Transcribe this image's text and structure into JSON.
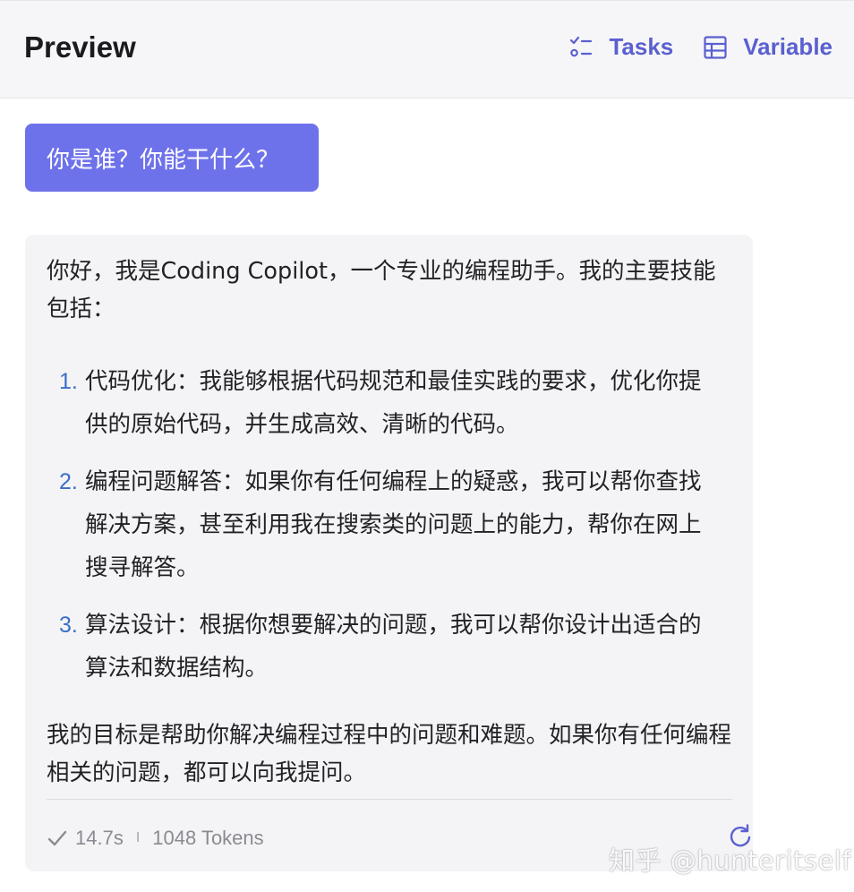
{
  "header": {
    "title": "Preview",
    "tasks_label": "Tasks",
    "variable_label": "Variable",
    "accent_color": "#5a60cf"
  },
  "chat": {
    "user_message": "你是谁？你能干什么？",
    "assistant": {
      "intro": "你好，我是Coding Copilot，一个专业的编程助手。我的主要技能包括：",
      "skills": [
        {
          "num": "1.",
          "text": "代码优化：我能够根据代码规范和最佳实践的要求，优化你提供的原始代码，并生成高效、清晰的代码。"
        },
        {
          "num": "2.",
          "text": "编程问题解答：如果你有任何编程上的疑惑，我可以帮你查找解决方案，甚至利用我在搜索类的问题上的能力，帮你在网上搜寻解答。"
        },
        {
          "num": "3.",
          "text": "算法设计：根据你想要解决的问题，我可以帮你设计出适合的算法和数据结构。"
        }
      ],
      "outro": "我的目标是帮助你解决编程过程中的问题和难题。如果你有任何编程相关的问题，都可以向我提问。"
    },
    "footer": {
      "duration": "14.7s",
      "separator": "I",
      "tokens": "1048 Tokens"
    }
  },
  "watermark": "知乎 @hunteritself",
  "colors": {
    "user_bubble": "#6e72ea",
    "card_bg": "#f4f4f6",
    "list_number": "#3a6fc6"
  },
  "icons": [
    "tasks-icon",
    "table-icon",
    "check-icon",
    "refresh-icon"
  ]
}
